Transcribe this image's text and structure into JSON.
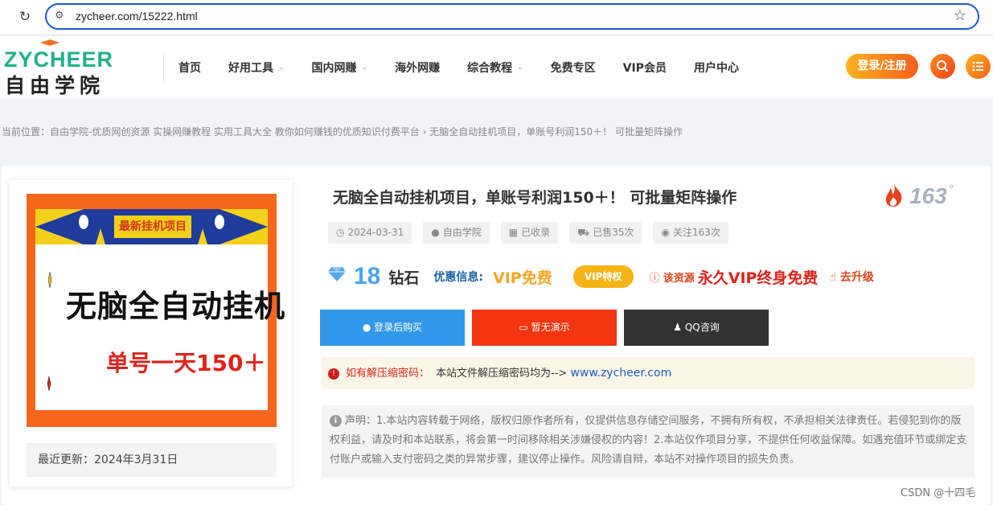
{
  "browser": {
    "url": "zycheer.com/15222.html"
  },
  "header": {
    "logo_en": "ZYCHEER",
    "logo_cn": "自由学院",
    "nav": [
      {
        "label": "首页",
        "caret": false
      },
      {
        "label": "好用工具",
        "caret": true
      },
      {
        "label": "国内网赚",
        "caret": true
      },
      {
        "label": "海外网赚",
        "caret": false
      },
      {
        "label": "综合教程",
        "caret": true
      },
      {
        "label": "免费专区",
        "caret": false
      },
      {
        "label": "VIP会员",
        "caret": false
      },
      {
        "label": "用户中心",
        "caret": false
      }
    ],
    "login_label": "登录/注册",
    "colors": {
      "accent": "#f65f1c",
      "accent_light": "#fcb21d",
      "brand_green": "#1fb08c"
    }
  },
  "breadcrumb": {
    "prefix": "当前位置：",
    "site": "自由学院-优质网创资源 实操网赚教程 实用工具大全 教你如何赚钱的优质知识付费平台",
    "separator": " › ",
    "current": "无脑全自动挂机项目，单账号利润150＋！ 可批量矩阵操作"
  },
  "thumb": {
    "banner": "最新挂机项目",
    "main": "无脑全自动挂机",
    "sub": "单号一天150＋",
    "update_label": "最近更新：",
    "update_value": "2024年3月31日"
  },
  "post": {
    "title": "无脑全自动挂机项目，单账号利润150＋！ 可批量矩阵操作",
    "hot": "163",
    "hot_unit": "°",
    "meta": [
      {
        "icon": "clock-icon",
        "glyph": "◷",
        "text": "2024-03-31"
      },
      {
        "icon": "user-icon",
        "glyph": "●",
        "text": "自由学院"
      },
      {
        "icon": "windows-icon",
        "glyph": "▦",
        "text": "已收录"
      },
      {
        "icon": "cart-icon",
        "glyph": "⛟",
        "text": "已售35次"
      },
      {
        "icon": "eye-icon",
        "glyph": "◉",
        "text": "关注163次"
      }
    ],
    "price": "18",
    "price_unit": "钻石",
    "promo_label": "优惠信息:",
    "promo_value": "VIP免费",
    "vip_badge": "VIP特权",
    "res_label": "该资源",
    "res_value": "永久VIP终身免费",
    "upgrade": "去升级",
    "buttons": {
      "buy": "登录后购买",
      "demo": "暂无演示",
      "qq": "QQ咨询"
    },
    "notice_label": "如有解压缩密码：",
    "notice_text": "本站文件解压缩密码均为-->",
    "notice_link": "www.zycheer.com",
    "disclaimer": "声明：1.本站内容转载于网络，版权归原作者所有，仅提供信息存储空间服务，不拥有所有权，不承担相关法律责任。若侵犯到你的版权利益，请及时和本站联系，将会第一时间移除相关涉嫌侵权的内容！2.本站仅作项目分享，不提供任何收益保障。如遇充值环节或绑定支付账户或输入支付密码之类的异常步骤，建议停止操作。风险请自辩，本站不对操作项目的损失负责。"
  },
  "watermark": "CSDN @十四毛"
}
